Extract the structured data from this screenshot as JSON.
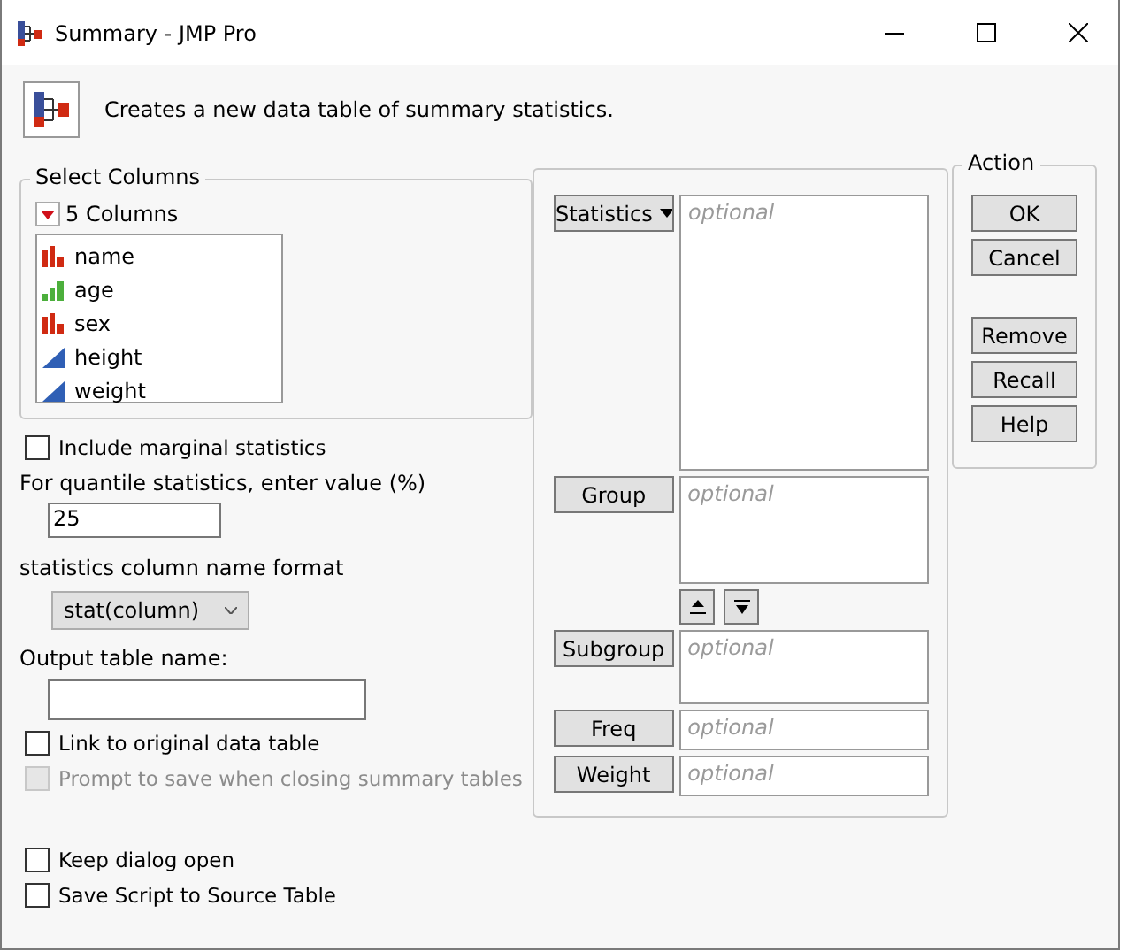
{
  "window": {
    "title": "Summary - JMP Pro"
  },
  "description": "Creates a new data table of summary statistics.",
  "select_columns": {
    "title": "Select Columns",
    "count_label": "5 Columns",
    "columns": [
      {
        "name": "name",
        "kind": "nominal"
      },
      {
        "name": "age",
        "kind": "ordinal"
      },
      {
        "name": "sex",
        "kind": "nominal"
      },
      {
        "name": "height",
        "kind": "continuous"
      },
      {
        "name": "weight",
        "kind": "continuous"
      }
    ]
  },
  "include_marginal": {
    "label": "Include marginal statistics",
    "checked": false,
    "disabled": false
  },
  "quantile": {
    "label": "For quantile statistics, enter value (%)",
    "value": "25"
  },
  "name_format": {
    "label": "statistics column name format",
    "value": "stat(column)"
  },
  "output_table": {
    "label": "Output table name:"
  },
  "options": [
    {
      "label": "Link to original data table",
      "checked": false,
      "disabled": false
    },
    {
      "label": "Prompt to save when closing summary tables",
      "checked": false,
      "disabled": true
    }
  ],
  "roles": [
    {
      "label": "Statistics",
      "placeholder": "optional",
      "kind": "tall",
      "dropdown": true
    },
    {
      "label": "Group",
      "placeholder": "optional",
      "kind": "medium",
      "dropdown": false,
      "order_buttons": true
    },
    {
      "label": "Subgroup",
      "placeholder": "optional",
      "kind": "small",
      "dropdown": false
    },
    {
      "label": "Freq",
      "placeholder": "optional",
      "kind": "single",
      "dropdown": false
    },
    {
      "label": "Weight",
      "placeholder": "optional",
      "kind": "single",
      "dropdown": false
    }
  ],
  "action": {
    "title": "Action",
    "buttons": [
      {
        "label": "OK",
        "gap_before": false
      },
      {
        "label": "Cancel",
        "gap_before": false
      },
      {
        "label": "Remove",
        "gap_before": true
      },
      {
        "label": "Recall",
        "gap_before": false
      },
      {
        "label": "Help",
        "gap_before": false
      }
    ]
  },
  "bottom_options": [
    {
      "label": "Keep dialog open",
      "checked": false,
      "disabled": false
    },
    {
      "label": "Save Script to Source Table",
      "checked": false,
      "disabled": false
    }
  ]
}
